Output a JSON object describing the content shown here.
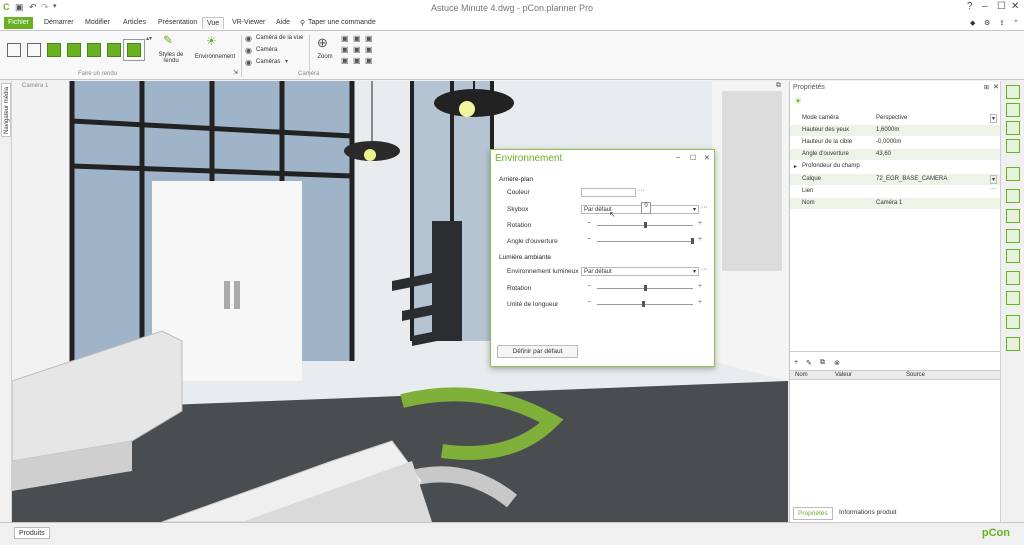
{
  "window": {
    "title": "Astuce Minute 4.dwg - pCon.planner Pro",
    "buttons": [
      "?",
      "–",
      "☐",
      "✕"
    ]
  },
  "tabs": [
    "Fichier",
    "Démarrer",
    "Modifier",
    "Articles",
    "Présentation",
    "Vue",
    "VR-Viewer",
    "Aide"
  ],
  "command_search": "Taper une commande",
  "ribbon": {
    "styles_label": "Styles de rendu",
    "environnement_label": "Environnement",
    "camera_vue_label": "Caméra de la vue",
    "camera_label": "Caméra",
    "cameras_label": "Caméras",
    "zoom_label": "Zoom",
    "group_render": "Faire un rendu",
    "group_camera": "Caméra"
  },
  "left_nav": "Navigateur média",
  "viewport_label": "Caméra 1",
  "env_dialog": {
    "title": "Environnement",
    "section_bg": "Arrière-plan",
    "couleur": "Couleur",
    "skybox": "Skybox",
    "skybox_value": "Par défaut",
    "tooltip": "0",
    "rotation": "Rotation",
    "angle": "Angle d'ouverture",
    "section_light": "Lumière ambiante",
    "env_lumineux": "Environnement lumineux",
    "env_lumineux_value": "Par défaut",
    "rotation2": "Rotation",
    "unite": "Unité de longueur",
    "reset_button": "Définir par défaut"
  },
  "properties": {
    "title": "Propriétés",
    "rows": [
      {
        "k": "Mode caméra",
        "v": "Perspective"
      },
      {
        "k": "Hauteur des yeux",
        "v": "1,6000m"
      },
      {
        "k": "Hauteur de la cible",
        "v": "-0,0000m"
      },
      {
        "k": "Angle d'ouverture",
        "v": "43,60"
      },
      {
        "k": "Profondeur du champ",
        "v": ""
      },
      {
        "k": "Calque",
        "v": "72_EGR_BASE_CAMERA"
      },
      {
        "k": "Lien",
        "v": ""
      },
      {
        "k": "Nom",
        "v": "Caméra 1"
      }
    ],
    "table_headers": [
      "Nom",
      "Valeur",
      "Source"
    ],
    "bottom_tabs": [
      "Propriétés",
      "Informations produit"
    ]
  },
  "status": {
    "products_tab": "Produits",
    "logo": "pCon"
  },
  "colors": {
    "accent": "#6ab023"
  }
}
